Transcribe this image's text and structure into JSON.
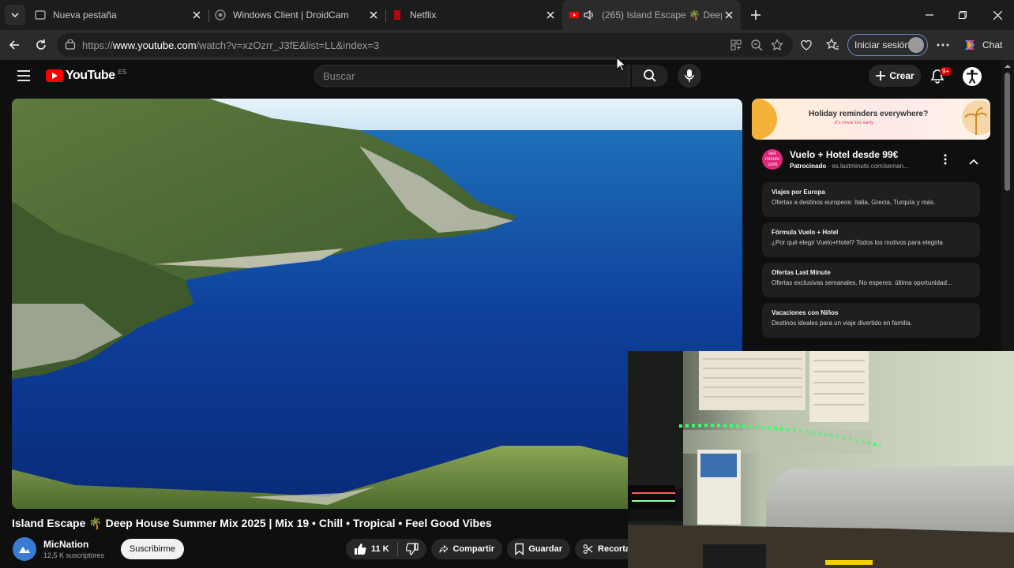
{
  "browser": {
    "tabs": [
      {
        "title": "Nueva pestaña",
        "active": false
      },
      {
        "title": "Windows Client | DroidCam",
        "active": false
      },
      {
        "title": "Netflix",
        "active": false
      },
      {
        "title": "(265) Island Escape 🌴 Deep",
        "active": true
      }
    ],
    "url_prefix": "https://",
    "url_domain": "www.youtube.com",
    "url_path": "/watch?v=xzOzrr_J3fE&list=LL&index=3",
    "signin_label": "Iniciar sesión",
    "chat_label": "Chat"
  },
  "youtube": {
    "logo_text": "YouTube",
    "country_code": "ES",
    "search_placeholder": "Buscar",
    "create_label": "Crear",
    "notifications_badge": "9+",
    "video": {
      "title": "Island Escape 🌴 Deep House Summer Mix 2025 | Mix 19 • Chill • Tropical • Feel Good Vibes",
      "channel": "MicNation",
      "subscribers": "12,5 K suscriptores",
      "subscribe_label": "Suscribirme",
      "likes": "11 K",
      "share_label": "Compartir",
      "save_label": "Guardar",
      "clip_label": "Recorta"
    }
  },
  "ad": {
    "banner_text": "Holiday reminders everywhere?",
    "banner_sub": "It's never too early",
    "logo_text": "last minute .com",
    "title": "Vuelo + Hotel desde 99€",
    "sponsored": "Patrocinado",
    "domain": "· es.lastminute.com/seman...",
    "cards": [
      {
        "heading": "Viajes por Europa",
        "desc": "Ofertas a destinos europeos: Italia, Grecia, Turquía y más."
      },
      {
        "heading": "Fórmula Vuelo + Hotel",
        "desc": "¿Por qué elegir Vuelo+Hotel? Todos los motivos para elegirla"
      },
      {
        "heading": "Ofertas Last Minute",
        "desc": "Ofertas exclusivas semanales. No esperes: última oportunidad..."
      },
      {
        "heading": "Vacaciones con Niños",
        "desc": "Destinos ideales para un viaje divertido en familia."
      }
    ]
  },
  "colors": {
    "accent_red": "#ff0000",
    "signin_border": "#6a8cc7",
    "ad_pink": "#e0257b"
  }
}
